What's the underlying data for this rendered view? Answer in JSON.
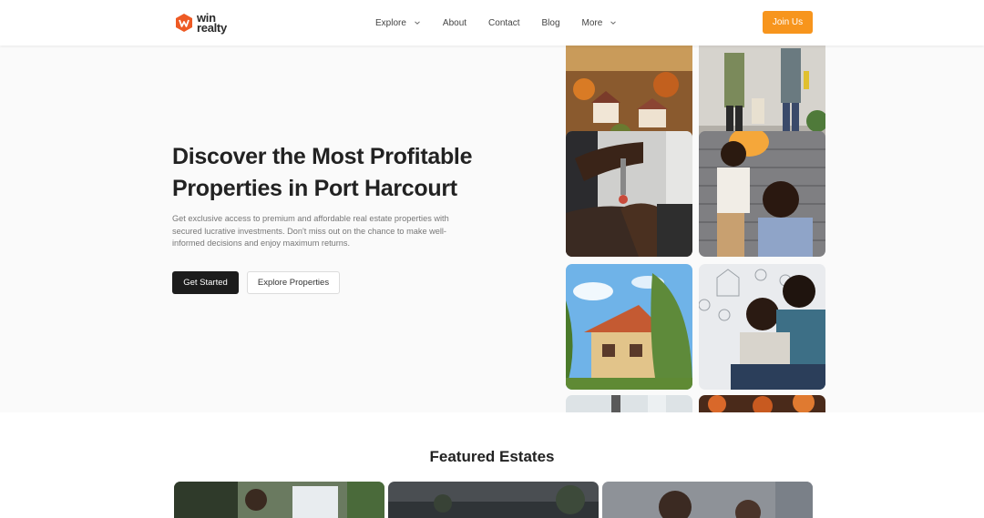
{
  "brand": {
    "line1": "win",
    "line2": "realty",
    "accent": "#f7951d",
    "logo_color": "#ee5a24"
  },
  "nav": {
    "items": [
      {
        "label": "Explore",
        "has_dropdown": true
      },
      {
        "label": "About",
        "has_dropdown": false
      },
      {
        "label": "Contact",
        "has_dropdown": false
      },
      {
        "label": "Blog",
        "has_dropdown": false
      },
      {
        "label": "More",
        "has_dropdown": true
      }
    ],
    "cta_label": "Join Us"
  },
  "hero": {
    "title": "Discover the Most Profitable Properties in Port Harcourt",
    "subtitle": "Get exclusive access to premium and affordable real estate properties with secured lucrative investments. Don't miss out on the chance to make well-informed decisions and enjoy maximum returns.",
    "primary_cta": "Get Started",
    "secondary_cta": "Explore Properties"
  },
  "gallery": {
    "images": [
      "village-aerial-photo",
      "family-walking-photo",
      "key-handover-photo",
      "mother-child-balloon-photo",
      "house-photo",
      "couple-photo",
      "partial-photo-1",
      "partial-photo-2"
    ]
  },
  "featured": {
    "title": "Featured Estates"
  }
}
